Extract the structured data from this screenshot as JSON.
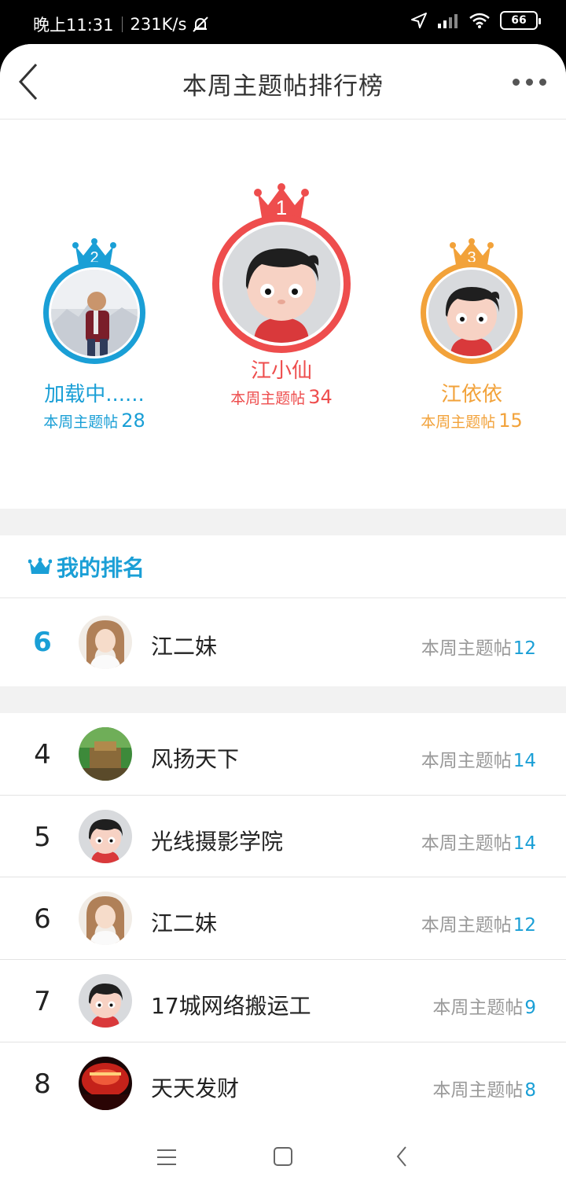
{
  "status_bar": {
    "time": "晚上11:31",
    "speed": "231K/s",
    "battery": "66"
  },
  "header": {
    "title": "本周主题帖排行榜"
  },
  "podium": {
    "first": {
      "rank": "1",
      "name": "江小仙",
      "label": "本周主题帖",
      "count": "34",
      "color": "#ee4d4d"
    },
    "second": {
      "rank": "2",
      "name": "加载中......",
      "label": "本周主题帖",
      "count": "28",
      "color": "#1a9fd6"
    },
    "third": {
      "rank": "3",
      "name": "江依依",
      "label": "本周主题帖",
      "count": "15",
      "color": "#f2a23a"
    }
  },
  "my_rank": {
    "section_label": "我的排名",
    "rank": "6",
    "name": "江二妹",
    "label": "本周主题帖",
    "count": "12"
  },
  "ranking": [
    {
      "rank": "4",
      "name": "风扬天下",
      "label": "本周主题帖",
      "count": "14",
      "avatar": "landscape"
    },
    {
      "rank": "5",
      "name": "光线摄影学院",
      "label": "本周主题帖",
      "count": "14",
      "avatar": "cartoon"
    },
    {
      "rank": "6",
      "name": "江二妹",
      "label": "本周主题帖",
      "count": "12",
      "avatar": "girl"
    },
    {
      "rank": "7",
      "name": "17城网络搬运工",
      "label": "本周主题帖",
      "count": "9",
      "avatar": "cartoon"
    },
    {
      "rank": "8",
      "name": "天天发财",
      "label": "本周主题帖",
      "count": "8",
      "avatar": "red-lights"
    }
  ],
  "colors": {
    "accent": "#1a9fd6",
    "first": "#ee4d4d",
    "third": "#f2a23a"
  }
}
